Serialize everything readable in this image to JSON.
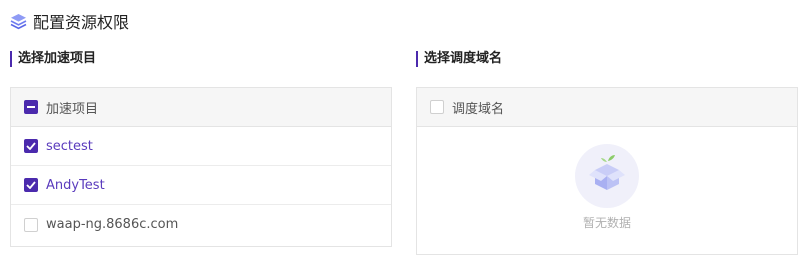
{
  "header": {
    "title": "配置资源权限",
    "icon": "layers-icon"
  },
  "left": {
    "section_label": "选择加速项目",
    "header_label": "加速项目",
    "header_state": "indeterminate",
    "items": [
      {
        "label": "sectest",
        "checked": true
      },
      {
        "label": "AndyTest",
        "checked": true
      },
      {
        "label": "waap-ng.8686c.com",
        "checked": false
      }
    ]
  },
  "right": {
    "section_label": "选择调度域名",
    "header_label": "调度域名",
    "header_state": "unchecked",
    "empty_text": "暂无数据",
    "empty_icon": "empty-box-icon"
  },
  "colors": {
    "accent": "#4b2aad",
    "checked_text": "#5a3bbd"
  }
}
